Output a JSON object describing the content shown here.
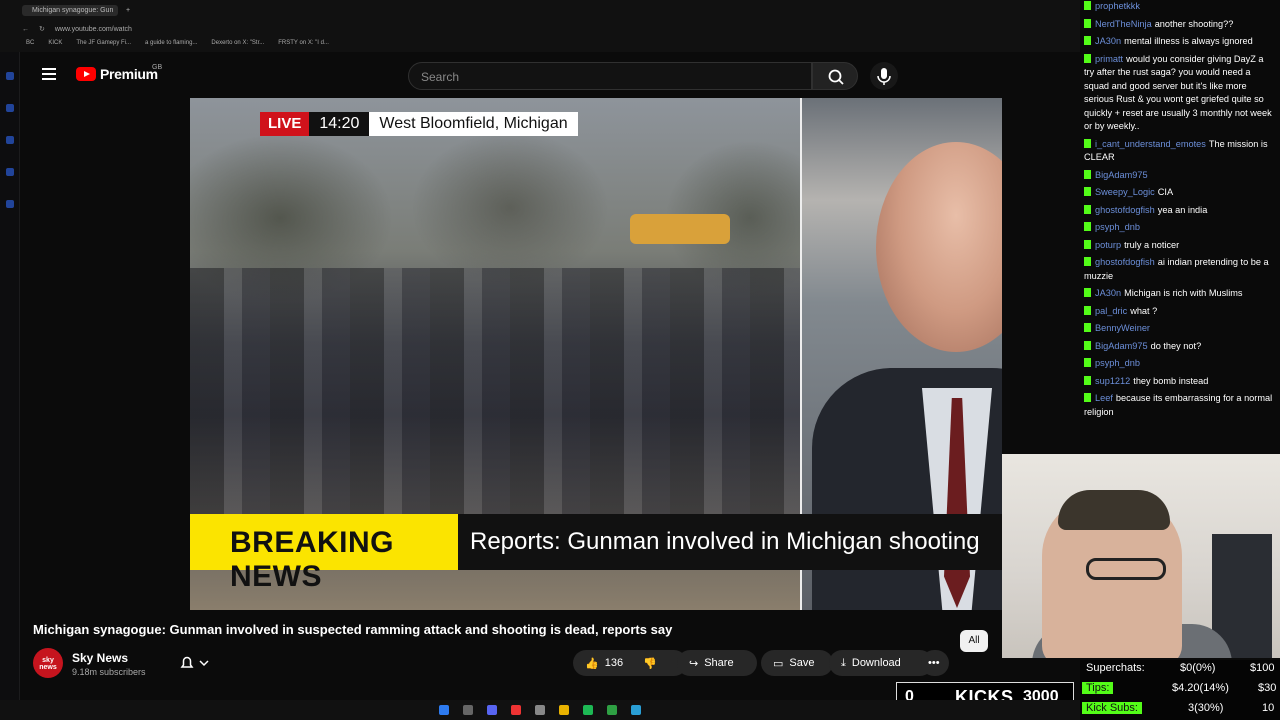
{
  "browser": {
    "tab_title": "Michigan synagogue: Gun",
    "url": "www.youtube.com/watch",
    "bookmarks": [
      "BC",
      "KICK",
      "The JF Gamepy Fi...",
      "a guide to flaming...",
      "Dexerto on X: \"Str...",
      "FRSTY on X: \"I d..."
    ]
  },
  "youtube": {
    "logo_text": "Premium",
    "region": "GB",
    "search_placeholder": "Search",
    "video": {
      "live_label": "LIVE",
      "time": "14:20",
      "location": "West Bloomfield, Michigan",
      "breaking_label": "BREAKING NEWS",
      "breaking_text": "Reports: Gunman involved in Michigan shooting"
    },
    "title": "Michigan synagogue: Gunman involved in suspected ramming attack and shooting is dead, reports say",
    "channel": {
      "name": "Sky News",
      "subscribers": "9.18m subscribers",
      "avatar_text": "sky news"
    },
    "actions": {
      "likes": "136",
      "share": "Share",
      "save": "Save",
      "download": "Download"
    },
    "filter_chip": "All"
  },
  "chat": {
    "messages": [
      {
        "user": "prophetkkk",
        "text": ""
      },
      {
        "user": "NerdTheNinja",
        "text": "another shooting??"
      },
      {
        "user": "JA30n",
        "text": "mental illness is always ignored"
      },
      {
        "user": "primatt",
        "text": "would you consider giving DayZ a try after the rust saga? you would need a squad and good server but it's like more serious Rust & you wont get griefed quite so quickly + reset are usually 3 monthly not week or by weekly.."
      },
      {
        "user": "i_cant_understand_emotes",
        "text": "The mission is CLEAR"
      },
      {
        "user": "BigAdam975",
        "text": ""
      },
      {
        "user": "Sweepy_Logic",
        "text": "CIA"
      },
      {
        "user": "ghostofdogfish",
        "text": "yea an india"
      },
      {
        "user": "psyph_dnb",
        "text": ""
      },
      {
        "user": "poturp",
        "text": "truly a noticer"
      },
      {
        "user": "ghostofdogfish",
        "text": "ai indian pretending to be a muzzie"
      },
      {
        "user": "JA30n",
        "text": "Michigan is rich with Muslims"
      },
      {
        "user": "pal_dric",
        "text": "what ?"
      },
      {
        "user": "BennyWeiner",
        "text": ""
      },
      {
        "user": "BigAdam975",
        "text": "do they not?"
      },
      {
        "user": "psyph_dnb",
        "text": ""
      },
      {
        "user": "sup1212",
        "text": "they bomb instead"
      },
      {
        "user": "Leef",
        "text": "because its embarrassing for a normal religion"
      }
    ]
  },
  "stats": {
    "superchats": {
      "label": "Superchats:",
      "value": "$0(0%)",
      "goal": "$100"
    },
    "tips": {
      "label": "Tips:",
      "value": "$4.20(14%)",
      "goal": "$30"
    },
    "kick_subs": {
      "label": "Kick Subs:",
      "value": "3(30%)",
      "goal": "10"
    },
    "colors": {
      "kick_green": "#53fc18"
    }
  },
  "kicks_bar": {
    "count": "0",
    "label": "KICKS",
    "goal": "3000"
  }
}
